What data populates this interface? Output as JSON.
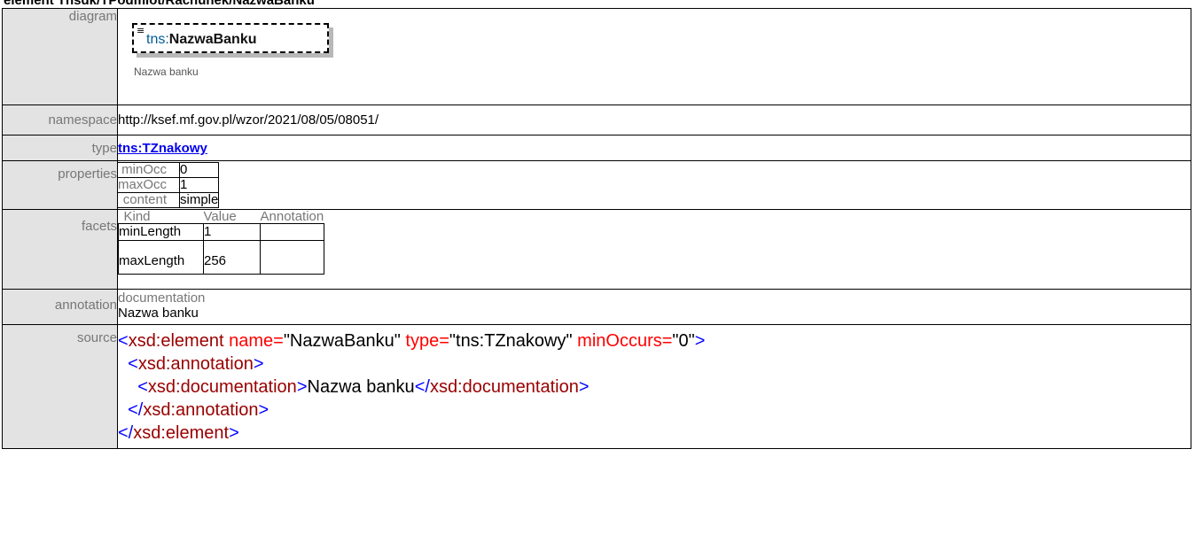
{
  "page_title": "element Tnsdk/TPodmiot/Rachunek/NazwaBanku",
  "labels": {
    "diagram": "diagram",
    "namespace": "namespace",
    "type": "type",
    "properties": "properties",
    "facets": "facets",
    "annotation": "annotation",
    "source": "source"
  },
  "diagram": {
    "prefix": "tns:",
    "name": "NazwaBanku",
    "doc": "Nazwa banku",
    "icon": "list-lines-icon"
  },
  "namespace": "http://ksef.mf.gov.pl/wzor/2021/08/05/08051/",
  "type": "tns:TZnakowy",
  "properties": [
    {
      "key": "minOcc",
      "value": "0"
    },
    {
      "key": "maxOcc",
      "value": "1"
    },
    {
      "key": "content",
      "value": "simple"
    }
  ],
  "facets": {
    "headers": [
      "Kind",
      "Value",
      "Annotation"
    ],
    "rows": [
      {
        "kind": "minLength",
        "value": "1",
        "annotation": ""
      },
      {
        "kind": "maxLength",
        "value": "256",
        "annotation": ""
      }
    ]
  },
  "annotation": {
    "kind": "documentation",
    "text": "Nazwa banku"
  },
  "source": {
    "l1_open": "<xsd:element",
    "l1_attr1": "name=",
    "l1_val1": "\"NazwaBanku\"",
    "l1_attr2": "type=",
    "l1_val2": "\"tns:TZnakowy\"",
    "l1_attr3": "minOccurs=",
    "l1_val3": "\"0\"",
    "l1_close": ">",
    "l2": "<xsd:annotation>",
    "l3_open": "<xsd:documentation>",
    "l3_text": "Nazwa banku",
    "l3_close": "</xsd:documentation>",
    "l4": "</xsd:annotation>",
    "l5": "</xsd:element>"
  },
  "colors": {
    "label_bg": "#e3e3e3",
    "link": "#0000ee",
    "xml_bracket": "#0000ff",
    "xml_tag": "#990000",
    "xml_attr": "#ff0000"
  }
}
